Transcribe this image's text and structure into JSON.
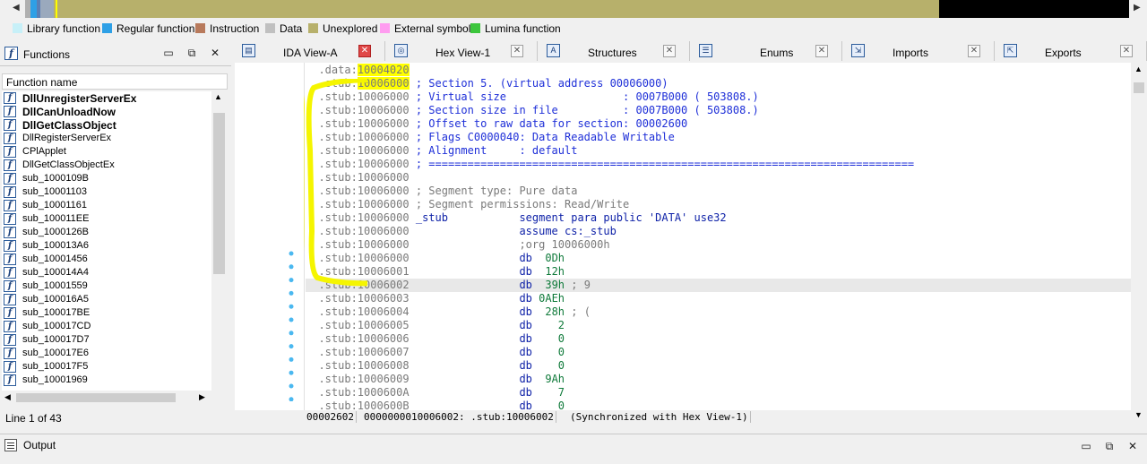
{
  "legend": [
    {
      "label": "Library function",
      "color": "#c7f0f8"
    },
    {
      "label": "Regular function",
      "color": "#2ea0e6"
    },
    {
      "label": "Instruction",
      "color": "#b87a5c"
    },
    {
      "label": "Data",
      "color": "#c0c0c0"
    },
    {
      "label": "Unexplored",
      "color": "#b7b06b"
    },
    {
      "label": "External symbol",
      "color": "#ff9cf0"
    },
    {
      "label": "Lumina function",
      "color": "#3cc63c"
    }
  ],
  "functions_panel": {
    "title": "Functions",
    "column_header": "Function name",
    "status": "Line 1 of 43",
    "items": [
      {
        "name": "DllUnregisterServerEx",
        "bold": true
      },
      {
        "name": "DllCanUnloadNow",
        "bold": true
      },
      {
        "name": "DllGetClassObject",
        "bold": true
      },
      {
        "name": "DllRegisterServerEx",
        "bold": false
      },
      {
        "name": "CPlApplet",
        "bold": false
      },
      {
        "name": "DllGetClassObjectEx",
        "bold": false
      },
      {
        "name": "sub_1000109B",
        "bold": false
      },
      {
        "name": "sub_10001103",
        "bold": false
      },
      {
        "name": "sub_10001161",
        "bold": false
      },
      {
        "name": "sub_100011EE",
        "bold": false
      },
      {
        "name": "sub_1000126B",
        "bold": false
      },
      {
        "name": "sub_100013A6",
        "bold": false
      },
      {
        "name": "sub_10001456",
        "bold": false
      },
      {
        "name": "sub_100014A4",
        "bold": false
      },
      {
        "name": "sub_10001559",
        "bold": false
      },
      {
        "name": "sub_100016A5",
        "bold": false
      },
      {
        "name": "sub_100017BE",
        "bold": false
      },
      {
        "name": "sub_100017CD",
        "bold": false
      },
      {
        "name": "sub_100017D7",
        "bold": false
      },
      {
        "name": "sub_100017E6",
        "bold": false
      },
      {
        "name": "sub_100017F5",
        "bold": false
      },
      {
        "name": "sub_10001969",
        "bold": false
      }
    ]
  },
  "tabs": [
    {
      "label": "IDA View-A",
      "icon": "ida-view-icon",
      "active": true
    },
    {
      "label": "Hex View-1",
      "icon": "hex-view-icon",
      "active": false
    },
    {
      "label": "Structures",
      "icon": "structures-icon",
      "active": false
    },
    {
      "label": "Enums",
      "icon": "enums-icon",
      "active": false
    },
    {
      "label": "Imports",
      "icon": "imports-icon",
      "active": false
    },
    {
      "label": "Exports",
      "icon": "exports-icon",
      "active": false
    }
  ],
  "disasm_lines": [
    {
      "addr": ".data:10004020",
      "parts": []
    },
    {
      "addr": ".stub:10006000",
      "parts": [
        {
          "t": "; Section 5. (virtual address 00006000)",
          "c": "cmt-blue"
        }
      ]
    },
    {
      "addr": ".stub:10006000",
      "parts": [
        {
          "t": "; Virtual size                  : 0007B000 ( 503808.)",
          "c": "cmt-blue"
        }
      ]
    },
    {
      "addr": ".stub:10006000",
      "parts": [
        {
          "t": "; Section size in file          : 0007B000 ( 503808.)",
          "c": "cmt-blue"
        }
      ]
    },
    {
      "addr": ".stub:10006000",
      "parts": [
        {
          "t": "; Offset to raw data for section: 00002600",
          "c": "cmt-blue"
        }
      ]
    },
    {
      "addr": ".stub:10006000",
      "parts": [
        {
          "t": "; Flags C0000040: Data Readable Writable",
          "c": "cmt-blue"
        }
      ]
    },
    {
      "addr": ".stub:10006000",
      "parts": [
        {
          "t": "; Alignment     : default",
          "c": "cmt-blue"
        }
      ]
    },
    {
      "addr": ".stub:10006000",
      "parts": [
        {
          "t": "; ===========================================================================",
          "c": "cmt-blue"
        }
      ]
    },
    {
      "addr": ".stub:10006000",
      "parts": []
    },
    {
      "addr": ".stub:10006000",
      "parts": [
        {
          "t": "; Segment type: Pure data",
          "c": "cmt-gray"
        }
      ]
    },
    {
      "addr": ".stub:10006000",
      "parts": [
        {
          "t": "; Segment permissions: Read/Write",
          "c": "cmt-gray"
        }
      ]
    },
    {
      "addr": ".stub:10006000",
      "parts": [
        {
          "t": "_stub           segment para public 'DATA' use32",
          "c": "kw-blue"
        }
      ]
    },
    {
      "addr": ".stub:10006000",
      "parts": [
        {
          "t": "                assume cs:_stub",
          "c": "kw-blue"
        }
      ]
    },
    {
      "addr": ".stub:10006000",
      "parts": [
        {
          "t": "                ;org 10006000h",
          "c": "cmt-gray"
        }
      ]
    },
    {
      "addr": ".stub:10006000",
      "parts": [
        {
          "t": "                db  ",
          "c": "kw-blue"
        },
        {
          "t": "0Dh",
          "c": "num"
        }
      ]
    },
    {
      "addr": ".stub:10006001",
      "parts": [
        {
          "t": "                db  ",
          "c": "kw-blue"
        },
        {
          "t": "12h",
          "c": "num"
        }
      ]
    },
    {
      "addr": ".stub:10006002",
      "parts": [
        {
          "t": "                db  ",
          "c": "kw-blue"
        },
        {
          "t": "39h",
          "c": "num"
        },
        {
          "t": " ; 9",
          "c": "cmt-gray"
        }
      ],
      "current": true
    },
    {
      "addr": ".stub:10006003",
      "parts": [
        {
          "t": "                db ",
          "c": "kw-blue"
        },
        {
          "t": "0AEh",
          "c": "num"
        }
      ]
    },
    {
      "addr": ".stub:10006004",
      "parts": [
        {
          "t": "                db  ",
          "c": "kw-blue"
        },
        {
          "t": "28h",
          "c": "num"
        },
        {
          "t": " ; (",
          "c": "cmt-gray"
        }
      ]
    },
    {
      "addr": ".stub:10006005",
      "parts": [
        {
          "t": "                db    ",
          "c": "kw-blue"
        },
        {
          "t": "2",
          "c": "num"
        }
      ]
    },
    {
      "addr": ".stub:10006006",
      "parts": [
        {
          "t": "                db    ",
          "c": "kw-blue"
        },
        {
          "t": "0",
          "c": "num"
        }
      ]
    },
    {
      "addr": ".stub:10006007",
      "parts": [
        {
          "t": "                db    ",
          "c": "kw-blue"
        },
        {
          "t": "0",
          "c": "num"
        }
      ]
    },
    {
      "addr": ".stub:10006008",
      "parts": [
        {
          "t": "                db    ",
          "c": "kw-blue"
        },
        {
          "t": "0",
          "c": "num"
        }
      ]
    },
    {
      "addr": ".stub:10006009",
      "parts": [
        {
          "t": "                db  ",
          "c": "kw-blue"
        },
        {
          "t": "9Ah",
          "c": "num"
        }
      ]
    },
    {
      "addr": ".stub:1000600A",
      "parts": [
        {
          "t": "                db    ",
          "c": "kw-blue"
        },
        {
          "t": "7",
          "c": "num"
        }
      ]
    },
    {
      "addr": ".stub:1000600B",
      "parts": [
        {
          "t": "                db    ",
          "c": "kw-blue"
        },
        {
          "t": "0",
          "c": "num"
        }
      ]
    }
  ],
  "disasm_status": {
    "offset": "00002602",
    "location": "0000000010006002: .stub:10006002",
    "sync": "(Synchronized with Hex View-1)"
  },
  "output_panel": {
    "title": "Output"
  },
  "window_buttons": {
    "minimize": "▭",
    "restore": "⧉",
    "close": "✕"
  },
  "colors": {
    "accent_highlight": "#ffff00",
    "annotation": "#f5f500",
    "nav_unexplored": "#b7b06b"
  }
}
